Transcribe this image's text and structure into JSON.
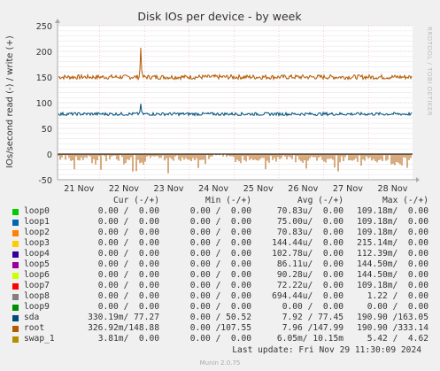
{
  "chart_data": {
    "type": "line",
    "title": "Disk IOs per device - by week",
    "ylabel": "IOs/second read (-) / write (+)",
    "ylim": [
      -50,
      250
    ],
    "yticks": [
      -50,
      0,
      50,
      100,
      150,
      200,
      250
    ],
    "x_tick_labels": [
      "21 Nov",
      "22 Nov",
      "23 Nov",
      "24 Nov",
      "25 Nov",
      "26 Nov",
      "27 Nov",
      "28 Nov"
    ],
    "grid": true,
    "series": [
      {
        "name": "root",
        "color": "#b35a00",
        "write_level": 150,
        "write_spike": 207,
        "read_level": -15,
        "read_min": -50
      },
      {
        "name": "sda",
        "color": "#00507a",
        "write_level": 78,
        "write_spike": 98
      }
    ]
  },
  "side_credit": "RRDTOOL / TOBI OETIKER",
  "legend": {
    "headers": {
      "cur": "Cur (-/+)",
      "min": "Min (-/+)",
      "avg": "Avg (-/+)",
      "max": "Max (-/+)"
    },
    "rows": [
      {
        "name": "loop0",
        "color": "#00cc00",
        "cur": "0.00 /  0.00",
        "min": "0.00 /  0.00",
        "avg": "70.83u/  0.00",
        "max": "109.18m/  0.00"
      },
      {
        "name": "loop1",
        "color": "#0066b3",
        "cur": "0.00 /  0.00",
        "min": "0.00 /  0.00",
        "avg": "75.00u/  0.00",
        "max": "109.18m/  0.00"
      },
      {
        "name": "loop2",
        "color": "#ff8000",
        "cur": "0.00 /  0.00",
        "min": "0.00 /  0.00",
        "avg": "70.83u/  0.00",
        "max": "109.18m/  0.00"
      },
      {
        "name": "loop3",
        "color": "#ffcc00",
        "cur": "0.00 /  0.00",
        "min": "0.00 /  0.00",
        "avg": "144.44u/  0.00",
        "max": "215.14m/  0.00"
      },
      {
        "name": "loop4",
        "color": "#330099",
        "cur": "0.00 /  0.00",
        "min": "0.00 /  0.00",
        "avg": "102.78u/  0.00",
        "max": "112.39m/  0.00"
      },
      {
        "name": "loop5",
        "color": "#990099",
        "cur": "0.00 /  0.00",
        "min": "0.00 /  0.00",
        "avg": "86.11u/  0.00",
        "max": "144.50m/  0.00"
      },
      {
        "name": "loop6",
        "color": "#ccff00",
        "cur": "0.00 /  0.00",
        "min": "0.00 /  0.00",
        "avg": "90.28u/  0.00",
        "max": "144.50m/  0.00"
      },
      {
        "name": "loop7",
        "color": "#ff0000",
        "cur": "0.00 /  0.00",
        "min": "0.00 /  0.00",
        "avg": "72.22u/  0.00",
        "max": "109.18m/  0.00"
      },
      {
        "name": "loop8",
        "color": "#808080",
        "cur": "0.00 /  0.00",
        "min": "0.00 /  0.00",
        "avg": "694.44u/  0.00",
        "max": "1.22 /  0.00"
      },
      {
        "name": "loop9",
        "color": "#008f00",
        "cur": "0.00 /  0.00",
        "min": "0.00 /  0.00",
        "avg": "0.00 /  0.00",
        "max": "0.00 /  0.00"
      },
      {
        "name": "sda",
        "color": "#00487d",
        "cur": "330.19m/ 77.27",
        "min": "0.00 / 50.52",
        "avg": "7.92 / 77.45",
        "max": "190.90 /163.05"
      },
      {
        "name": "root",
        "color": "#b35a00",
        "cur": "326.92m/148.88",
        "min": "0.00 /107.55",
        "avg": "7.96 /147.99",
        "max": "190.90 /333.14"
      },
      {
        "name": "swap_1",
        "color": "#b38f00",
        "cur": "3.81m/  0.00",
        "min": "0.00 /  0.00",
        "avg": "6.05m/ 10.15m",
        "max": "5.42 /  4.62"
      }
    ]
  },
  "last_update": "Last update: Fri Nov 29 11:30:09 2024",
  "munin_version": "Munin 2.0.75"
}
